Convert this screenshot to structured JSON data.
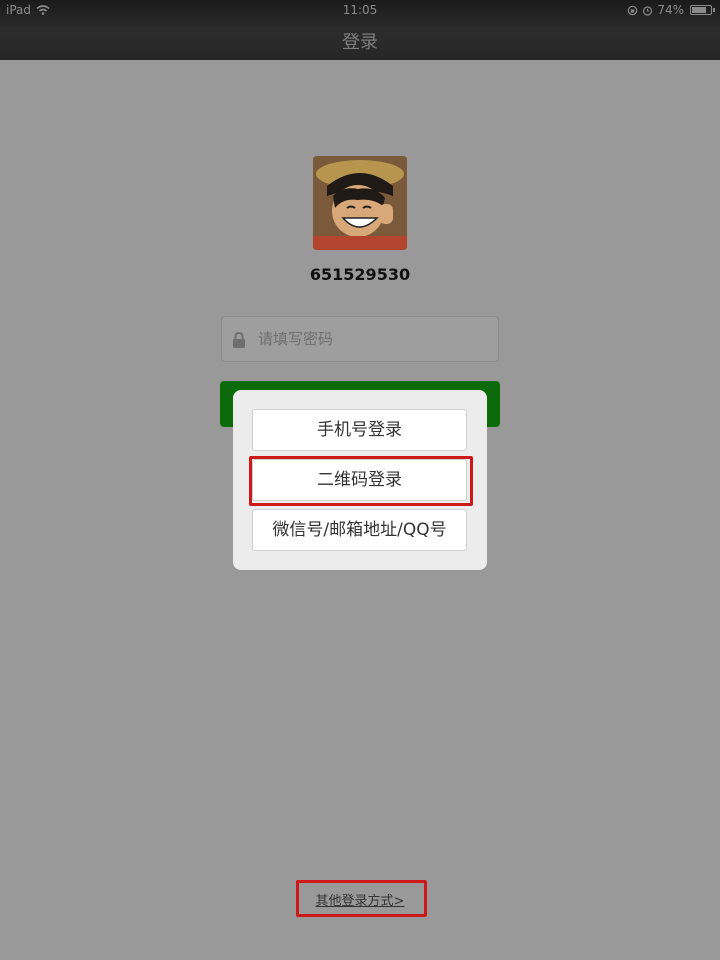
{
  "status_bar": {
    "device": "iPad",
    "time": "11:05",
    "battery": "74%"
  },
  "nav": {
    "title": "登录"
  },
  "profile": {
    "account_id": "651529530"
  },
  "password": {
    "placeholder": "请填写密码"
  },
  "popup": {
    "options": [
      {
        "label": "手机号登录"
      },
      {
        "label": "二维码登录"
      },
      {
        "label": "微信号/邮箱地址/QQ号"
      }
    ]
  },
  "footer": {
    "other_login_label": "其他登录方式>"
  },
  "colors": {
    "overlay_bg": "#999999",
    "login_green": "#0b6b0b",
    "highlight_red": "#cc1a1a"
  },
  "icons": {
    "wifi": "wifi-icon",
    "lock": "lock-icon",
    "battery": "battery-icon"
  }
}
